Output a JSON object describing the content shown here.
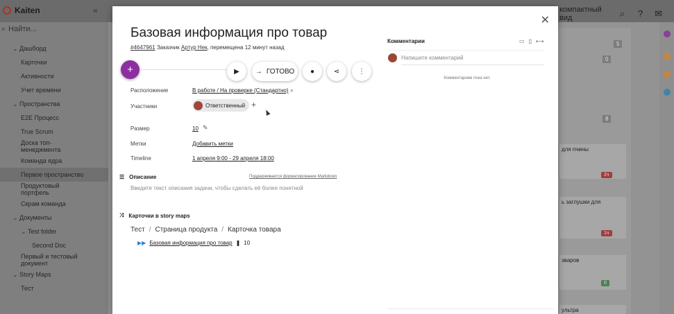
{
  "app": {
    "name": "Kaiten",
    "view_label": "компактный вид"
  },
  "sidebar": {
    "search_placeholder": "Найти...",
    "items": [
      {
        "label": "Дашборд",
        "level": 1,
        "caret": "⌄"
      },
      {
        "label": "Карточки",
        "level": 2
      },
      {
        "label": "Активности",
        "level": 2
      },
      {
        "label": "Учет времени",
        "level": 2
      },
      {
        "label": "Пространства",
        "level": 1,
        "caret": "⌄"
      },
      {
        "label": "E2E Процесс",
        "level": 2
      },
      {
        "label": "True Scrum",
        "level": 2
      },
      {
        "label": "Доска топ-менеджмента",
        "level": 2,
        "two_lines": true
      },
      {
        "label": "Команда ядра",
        "level": 2
      },
      {
        "label": "Первое пространство",
        "level": 2,
        "active": true
      },
      {
        "label": "Продуктовый портфель",
        "level": 2,
        "two_lines": true
      },
      {
        "label": "Скрам команда",
        "level": 2
      },
      {
        "label": "Документы",
        "level": 1,
        "caret": "⌄"
      },
      {
        "label": "Test folder",
        "level": 2,
        "caret": "⌄"
      },
      {
        "label": "Second Doc",
        "level": 3
      },
      {
        "label": "Первый и тестовый документ",
        "level": 2,
        "two_lines": true
      },
      {
        "label": "Story Maps",
        "level": 1,
        "caret": "⌄"
      },
      {
        "label": "Тест",
        "level": 2
      }
    ]
  },
  "board_bg": {
    "counts": [
      "5",
      "0",
      "8"
    ],
    "cards": [
      "для пчины",
      "ь заглушки для",
      "зваров",
      "ультра"
    ],
    "badges": [
      "2ч",
      "1ч",
      "0"
    ]
  },
  "card": {
    "title": "Базовая информация про товар",
    "id": "#4647961",
    "customer_label": "Заказчик",
    "customer_name": "Артур Нек",
    "moved_text": ", перемещена 12 минут назад",
    "ready_label": "ГОТОВО",
    "props": {
      "location_label": "Расположение",
      "location_value": "В работе / На проверке (Стандартно)",
      "members_label": "Участники",
      "member_role": "Ответственный",
      "size_label": "Размер",
      "size_value": "10",
      "tags_label": "Метки",
      "tags_value": "Добавить метки",
      "timeline_label": "Timeline",
      "timeline_value": "1 апреля 9:00 - 29 апреля 18:00"
    },
    "description": {
      "heading": "Описание",
      "markdown_note": "Поддерживается форматирование Markdown",
      "placeholder": "Введите текст описания задачи, чтобы сделать её более понятной"
    },
    "story_maps": {
      "heading": "Карточки в story maps",
      "crumbs": [
        "Тест",
        "Страница продукта",
        "Карточка товара"
      ],
      "card_link": "Базовая информация про товар",
      "card_size": "10"
    },
    "comments": {
      "heading": "Комментарии",
      "placeholder": "Напишите комментарий",
      "empty": "Комментариев пока нет."
    }
  },
  "colors": {
    "accent": "#8e2fa0",
    "link": "#2a7fd4"
  }
}
